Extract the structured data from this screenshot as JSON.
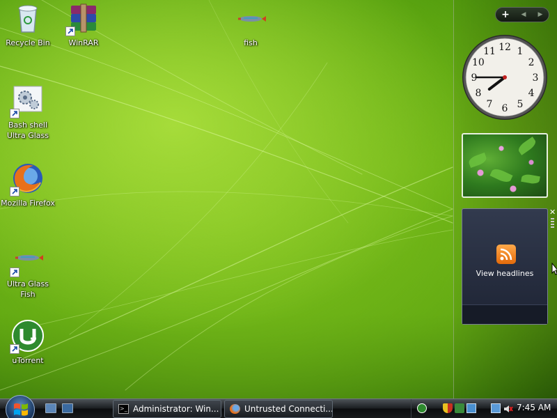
{
  "desktop": {
    "icons": [
      {
        "label_line1": "Recycle Bin",
        "label_line2": ""
      },
      {
        "label_line1": "WinRAR",
        "label_line2": ""
      },
      {
        "label_line1": "fish",
        "label_line2": ""
      },
      {
        "label_line1": "Bash shell",
        "label_line2": "Ultra Glass"
      },
      {
        "label_line1": "Mozilla Firefox",
        "label_line2": ""
      },
      {
        "label_line1": "Ultra Glass",
        "label_line2": "Fish"
      },
      {
        "label_line1": "uTorrent",
        "label_line2": ""
      }
    ]
  },
  "sidebar": {
    "add_symbol": "+",
    "prev_symbol": "◀",
    "next_symbol": "▶",
    "clock": {
      "time": "7:45",
      "numerals": [
        "12",
        "1",
        "2",
        "3",
        "4",
        "5",
        "6",
        "7",
        "8",
        "9",
        "10",
        "11"
      ]
    },
    "feed": {
      "label": "View headlines",
      "close_symbol": "✕"
    }
  },
  "taskbar": {
    "tasks": [
      {
        "label": "Administrator: Win...",
        "icon": "cmd-icon"
      },
      {
        "label": "Untrusted Connecti...",
        "icon": "firefox-icon"
      }
    ],
    "tray_icons": [
      "utorrent-icon",
      "shield-icon",
      "network-icon",
      "security-icon",
      "volume-muted-icon"
    ],
    "clock": "7:45 AM"
  },
  "colors": {
    "wallpaper_green": "#66ad13",
    "taskbar_dark": "#1b1e21",
    "feed_orange": "#f08a24"
  }
}
